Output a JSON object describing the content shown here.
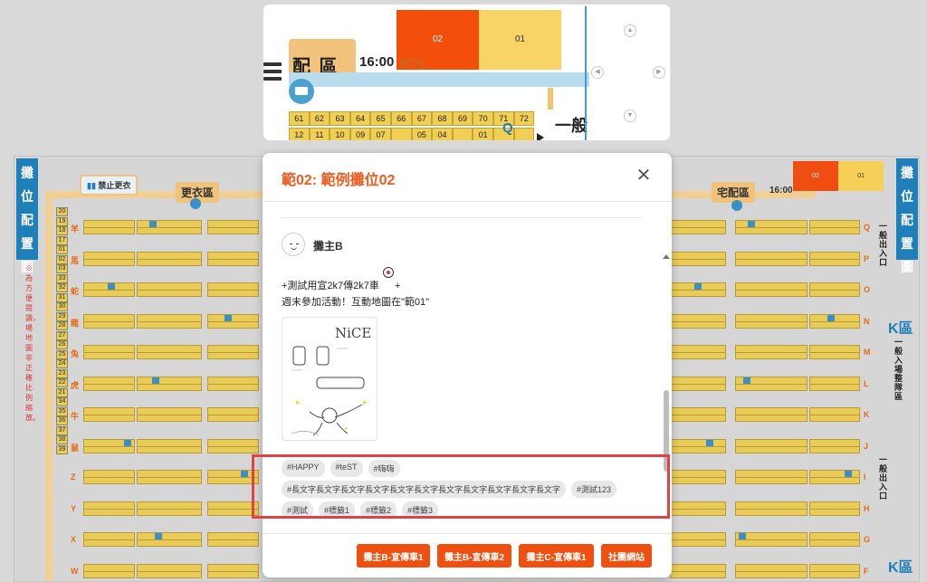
{
  "colors": {
    "accent": "#f15a1e",
    "stall_yellow": "#e9cb57",
    "stall_selected": "#f44e0c",
    "zone_blue": "#1f7fb8",
    "highlight_frame": "#e04343"
  },
  "background_map": {
    "side_title_left": "攤位配置圖",
    "side_title_right": "攤位配置圖",
    "side_note": "※為方便閱讀，場地圖非正確比例縮放。",
    "no_changing_label": "禁止更衣",
    "changing_area": "更衣區",
    "delivery_area": "宅配區",
    "delivery_time": "16:00",
    "left_row_letters": [
      "羊",
      "馬",
      "蛇",
      "龍",
      "兔",
      "虎",
      "牛",
      "鼠",
      "Z",
      "Y",
      "X",
      "W"
    ],
    "left_numbers": [
      "20",
      "19",
      "18",
      "17",
      "01",
      "02",
      "03",
      "33",
      "32",
      "31",
      "30",
      "29",
      "28",
      "27",
      "26",
      "25",
      "24",
      "23",
      "22",
      "21",
      "34",
      "35",
      "36",
      "37",
      "38",
      "39"
    ],
    "right_row_letters": [
      "Q",
      "P",
      "O",
      "N",
      "M",
      "L",
      "K",
      "J",
      "I",
      "H",
      "G",
      "F"
    ],
    "k_zone_top": "K區",
    "k_zone_top_sub": "一般入場整隊區",
    "k_zone_bottom": "K區",
    "general_entry_top": "一般出入口",
    "general_entry_bottom": "一般出入口",
    "ghost_02": "02",
    "ghost_01": "01"
  },
  "minimap": {
    "stall_02": "02",
    "stall_01": "01",
    "area_title": "配 區",
    "time": "16:00",
    "open_text": "開放",
    "top_row": [
      "61",
      "62",
      "63",
      "64",
      "65",
      "66",
      "67",
      "68",
      "69",
      "70",
      "71",
      "72"
    ],
    "bottom_row": [
      "12",
      "11",
      "10",
      "09",
      "07",
      "",
      "05",
      "04",
      "",
      "01",
      "",
      ""
    ],
    "zone_letter": "Q",
    "general_label": "一般",
    "controls": {
      "up": "▲",
      "left": "◀",
      "right": "▶",
      "down": "▼"
    }
  },
  "modal": {
    "title": "範02: 範例攤位02",
    "close": "✕",
    "owner_name": "攤主B",
    "desc_line1": "+測試用宣2k7傳2k7車",
    "desc_line1_suffix": "+",
    "desc_line2": "週末參加活動！互動地圖在\"範01\"",
    "sketch_text": "NiCE",
    "tags_row1": [
      "#HAPPY",
      "#teST",
      "#嗨嗨"
    ],
    "tags_row2": [
      "#長文字長文字長文字長文字長文字長文字長文字長文字長文字長文字長文字",
      "#測試123"
    ],
    "tags_row3": [
      "#測試",
      "#標籤1",
      "#標籤2",
      "#標籤3"
    ],
    "buttons": [
      "攤主B-宣傳車1",
      "攤主B-宣傳車2",
      "攤主C-宣傳車1",
      "社團網站"
    ]
  }
}
